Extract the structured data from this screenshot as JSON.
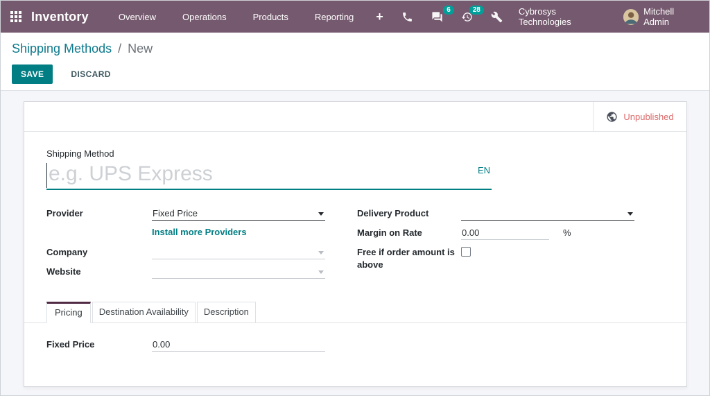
{
  "colors": {
    "navbar_bg": "#75596e",
    "accent_teal": "#017e84",
    "badge_teal": "#00a09a",
    "breadcrumb_link": "#0e7a8c",
    "unpublished_red": "#dd6b6b",
    "tab_active_top": "#512a44"
  },
  "navbar": {
    "app_name": "Inventory",
    "menu": [
      "Overview",
      "Operations",
      "Products",
      "Reporting"
    ],
    "plus_glyph": "+",
    "badges": {
      "messages": "6",
      "activities": "28"
    },
    "company": "Cybrosys Technologies",
    "user": "Mitchell Admin"
  },
  "control_panel": {
    "breadcrumb_parent": "Shipping Methods",
    "breadcrumb_separator": "/",
    "breadcrumb_current": "New",
    "save_label": "SAVE",
    "discard_label": "DISCARD"
  },
  "sheet": {
    "status_button_label": "Unpublished",
    "title_field": {
      "label": "Shipping Method",
      "placeholder": "e.g. UPS Express",
      "lang": "EN"
    },
    "fields": {
      "provider": {
        "label": "Provider",
        "value": "Fixed Price"
      },
      "install_link": "Install more Providers",
      "company": {
        "label": "Company",
        "value": ""
      },
      "website": {
        "label": "Website",
        "value": ""
      },
      "delivery_product": {
        "label": "Delivery Product",
        "value": ""
      },
      "margin": {
        "label": "Margin on Rate",
        "value": "0.00",
        "suffix": "%"
      },
      "free_over": {
        "label": "Free if order amount is above",
        "checked": false
      }
    },
    "tabs": [
      {
        "label": "Pricing",
        "active": true
      },
      {
        "label": "Destination Availability",
        "active": false
      },
      {
        "label": "Description",
        "active": false
      }
    ],
    "pricing": {
      "fixed_price_label": "Fixed Price",
      "fixed_price_value": "0.00"
    }
  }
}
